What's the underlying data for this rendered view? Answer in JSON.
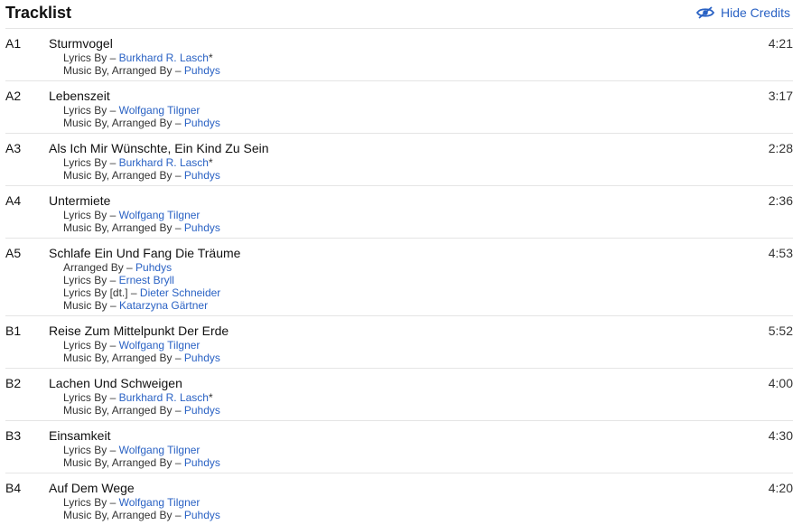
{
  "header": {
    "title": "Tracklist",
    "hide_credits_label": "Hide Credits",
    "icon": "eye-slash-icon",
    "accent_color": "#2a62c4"
  },
  "tracks": [
    {
      "position": "A1",
      "title": "Sturmvogel",
      "duration": "4:21",
      "credits": [
        {
          "role": "Lyrics By – ",
          "artist": "Burkhard R. Lasch",
          "suffix": "*"
        },
        {
          "role": "Music By, Arranged By – ",
          "artist": "Puhdys",
          "suffix": ""
        }
      ]
    },
    {
      "position": "A2",
      "title": "Lebenszeit",
      "duration": "3:17",
      "credits": [
        {
          "role": "Lyrics By – ",
          "artist": "Wolfgang Tilgner",
          "suffix": ""
        },
        {
          "role": "Music By, Arranged By – ",
          "artist": "Puhdys",
          "suffix": ""
        }
      ]
    },
    {
      "position": "A3",
      "title": "Als Ich Mir Wünschte, Ein Kind Zu Sein",
      "duration": "2:28",
      "credits": [
        {
          "role": "Lyrics By – ",
          "artist": "Burkhard R. Lasch",
          "suffix": "*"
        },
        {
          "role": "Music By, Arranged By – ",
          "artist": "Puhdys",
          "suffix": ""
        }
      ]
    },
    {
      "position": "A4",
      "title": "Untermiete",
      "duration": "2:36",
      "credits": [
        {
          "role": "Lyrics By – ",
          "artist": "Wolfgang Tilgner",
          "suffix": ""
        },
        {
          "role": "Music By, Arranged By – ",
          "artist": "Puhdys",
          "suffix": ""
        }
      ]
    },
    {
      "position": "A5",
      "title": "Schlafe Ein Und Fang Die Träume",
      "duration": "4:53",
      "credits": [
        {
          "role": "Arranged By – ",
          "artist": "Puhdys",
          "suffix": ""
        },
        {
          "role": "Lyrics By – ",
          "artist": "Ernest Bryll",
          "suffix": ""
        },
        {
          "role": "Lyrics By [dt.] – ",
          "artist": "Dieter Schneider",
          "suffix": ""
        },
        {
          "role": "Music By – ",
          "artist": "Katarzyna Gärtner",
          "suffix": ""
        }
      ]
    },
    {
      "position": "B1",
      "title": "Reise Zum Mittelpunkt Der Erde",
      "duration": "5:52",
      "credits": [
        {
          "role": "Lyrics By – ",
          "artist": "Wolfgang Tilgner",
          "suffix": ""
        },
        {
          "role": "Music By, Arranged By – ",
          "artist": "Puhdys",
          "suffix": ""
        }
      ]
    },
    {
      "position": "B2",
      "title": "Lachen Und Schweigen",
      "duration": "4:00",
      "credits": [
        {
          "role": "Lyrics By – ",
          "artist": "Burkhard R. Lasch",
          "suffix": "*"
        },
        {
          "role": "Music By, Arranged By – ",
          "artist": "Puhdys",
          "suffix": ""
        }
      ]
    },
    {
      "position": "B3",
      "title": "Einsamkeit",
      "duration": "4:30",
      "credits": [
        {
          "role": "Lyrics By – ",
          "artist": "Wolfgang Tilgner",
          "suffix": ""
        },
        {
          "role": "Music By, Arranged By – ",
          "artist": "Puhdys",
          "suffix": ""
        }
      ]
    },
    {
      "position": "B4",
      "title": "Auf Dem Wege",
      "duration": "4:20",
      "credits": [
        {
          "role": "Lyrics By – ",
          "artist": "Wolfgang Tilgner",
          "suffix": ""
        },
        {
          "role": "Music By, Arranged By – ",
          "artist": "Puhdys",
          "suffix": ""
        }
      ]
    }
  ]
}
